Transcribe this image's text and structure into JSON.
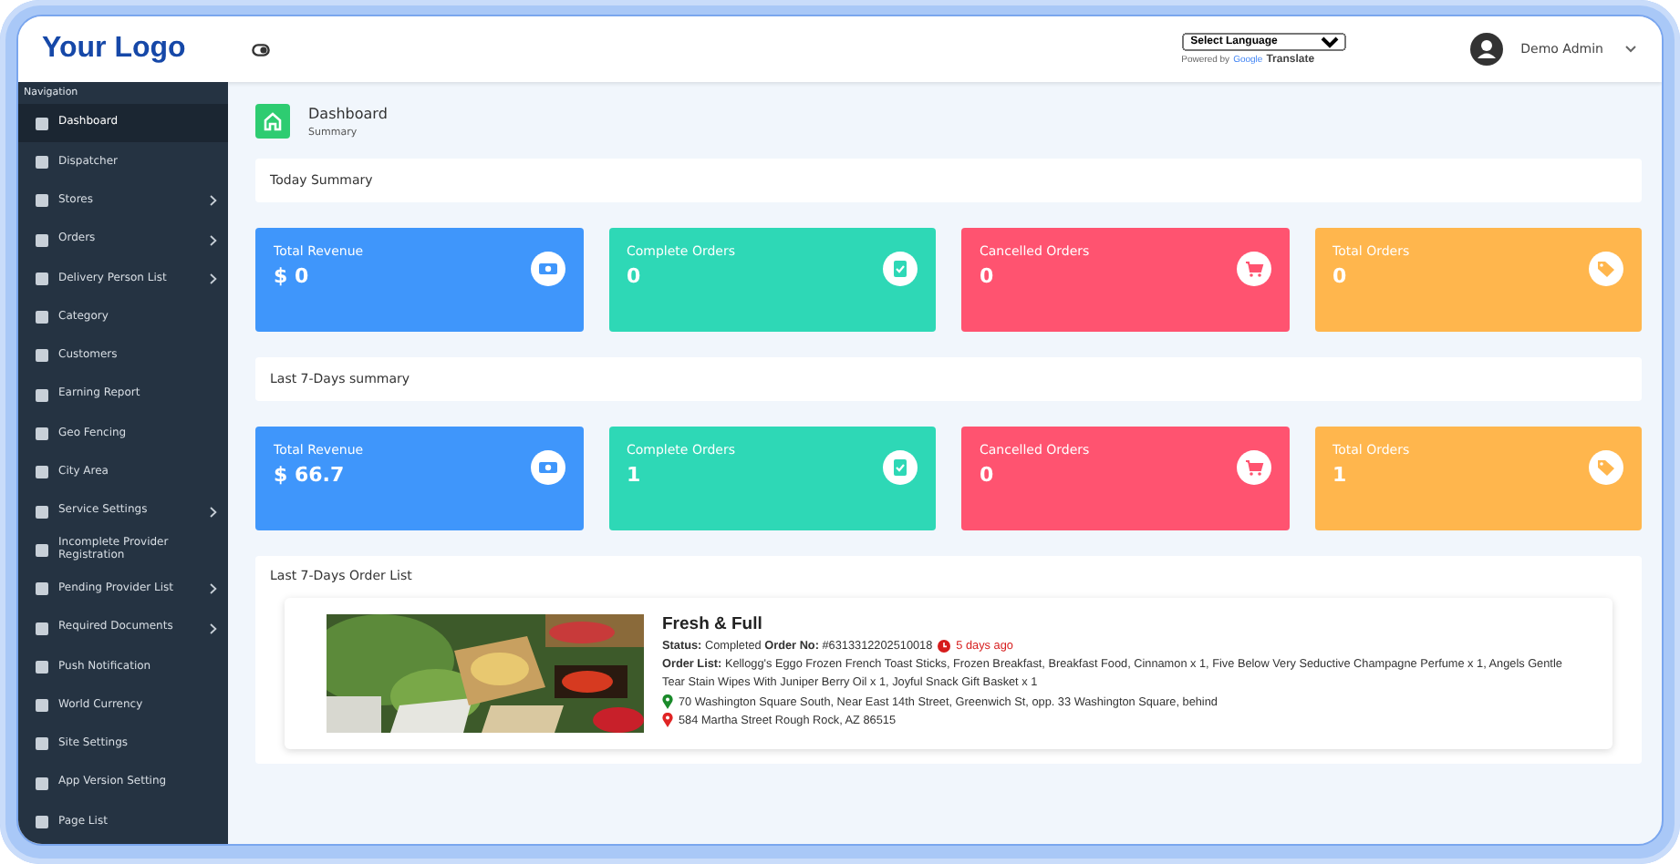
{
  "header": {
    "logo": "Your Logo",
    "language_select": "Select Language",
    "powered_by": "Powered by",
    "google": "Google",
    "translate": "Translate",
    "user": "Demo Admin"
  },
  "sidebar": {
    "heading": "Navigation",
    "items": [
      {
        "label": "Dashboard",
        "selected": true,
        "has_submenu": false
      },
      {
        "label": "Dispatcher",
        "selected": false,
        "has_submenu": false
      },
      {
        "label": "Stores",
        "selected": false,
        "has_submenu": true
      },
      {
        "label": "Orders",
        "selected": false,
        "has_submenu": true
      },
      {
        "label": "Delivery Person List",
        "selected": false,
        "has_submenu": true
      },
      {
        "label": "Category",
        "selected": false,
        "has_submenu": false
      },
      {
        "label": "Customers",
        "selected": false,
        "has_submenu": false
      },
      {
        "label": "Earning Report",
        "selected": false,
        "has_submenu": false
      },
      {
        "label": "Geo Fencing",
        "selected": false,
        "has_submenu": false
      },
      {
        "label": "City Area",
        "selected": false,
        "has_submenu": false
      },
      {
        "label": "Service Settings",
        "selected": false,
        "has_submenu": true
      },
      {
        "label": "Incomplete Provider Registration",
        "selected": false,
        "has_submenu": false
      },
      {
        "label": "Pending Provider List",
        "selected": false,
        "has_submenu": true
      },
      {
        "label": "Required Documents",
        "selected": false,
        "has_submenu": true
      },
      {
        "label": "Push Notification",
        "selected": false,
        "has_submenu": false
      },
      {
        "label": "World Currency",
        "selected": false,
        "has_submenu": false
      },
      {
        "label": "Site Settings",
        "selected": false,
        "has_submenu": false
      },
      {
        "label": "App Version Setting",
        "selected": false,
        "has_submenu": false
      },
      {
        "label": "Page List",
        "selected": false,
        "has_submenu": false
      }
    ]
  },
  "page_title": {
    "title": "Dashboard",
    "subtitle": "Summary"
  },
  "sections": [
    {
      "title": "Today Summary",
      "cards": [
        {
          "kind": "revenue",
          "label": "Total Revenue",
          "value": "$ 0",
          "color": "#3f96fb"
        },
        {
          "kind": "complete",
          "label": "Complete Orders",
          "value": "0",
          "color": "#2ed8b6"
        },
        {
          "kind": "cancelled",
          "label": "Cancelled Orders",
          "value": "0",
          "color": "#ff5370"
        },
        {
          "kind": "total",
          "label": "Total Orders",
          "value": "0",
          "color": "#ffb64d"
        }
      ]
    },
    {
      "title": "Last 7-Days summary",
      "cards": [
        {
          "kind": "revenue",
          "label": "Total Revenue",
          "value": "$ 66.7",
          "color": "#3f96fb"
        },
        {
          "kind": "complete",
          "label": "Complete Orders",
          "value": "1",
          "color": "#2ed8b6"
        },
        {
          "kind": "cancelled",
          "label": "Cancelled Orders",
          "value": "0",
          "color": "#ff5370"
        },
        {
          "kind": "total",
          "label": "Total Orders",
          "value": "1",
          "color": "#ffb64d"
        }
      ]
    }
  ],
  "order_list": {
    "title": "Last 7-Days Order List",
    "orders": [
      {
        "store": "Fresh & Full",
        "status": "**Status:** Completed **Order No:** #6313312202510018",
        "time": "5 days ago",
        "items": "**Order List:** Kellogg's Eggo Frozen French Toast Sticks, Frozen Breakfast, Breakfast Food, Cinnamon x 1, Five Below Very Seductive Champagne Perfume x 1, Angels Gentle Tear Stain Wipes With Juniper Berry Oil x 1, Joyful Snack Gift Basket x 1",
        "pickup": "70 Washington Square South, Near East 14th Street, Greenwich St, opp. 33 Washington Square, behind",
        "dropoff": "584 Martha Street Rough Rock, AZ 86515"
      }
    ]
  }
}
